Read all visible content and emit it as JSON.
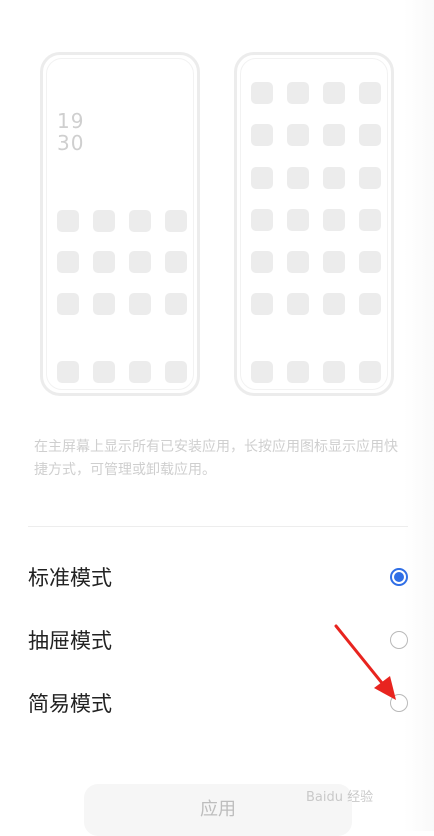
{
  "preview": {
    "clock_hour": "19",
    "clock_minute": "30"
  },
  "description": "在主屏幕上显示所有已安装应用，长按应用图标显示应用快捷方式，可管理或卸载应用。",
  "options": [
    {
      "label": "标准模式",
      "selected": true
    },
    {
      "label": "抽屉模式",
      "selected": false
    },
    {
      "label": "简易模式",
      "selected": false
    }
  ],
  "apply_label": "应用",
  "watermark": "Baidu 经验",
  "colors": {
    "accent": "#2f6ee6",
    "arrow": "#e8241f"
  }
}
